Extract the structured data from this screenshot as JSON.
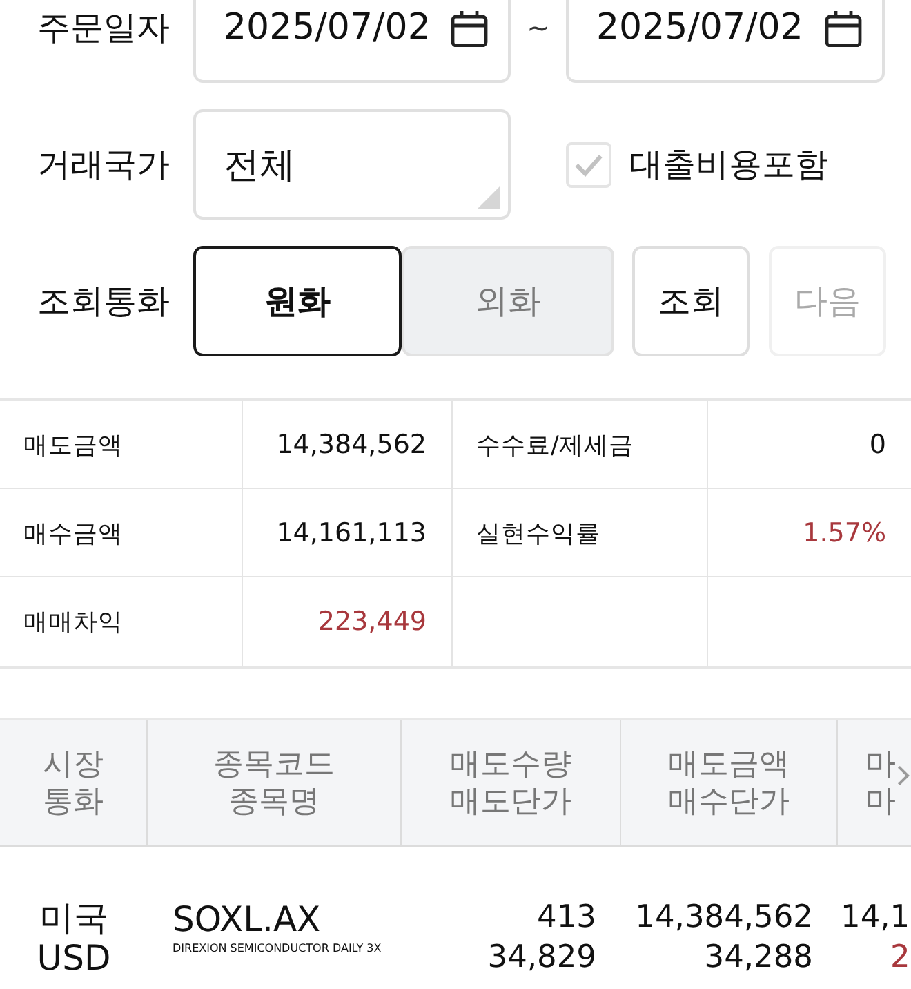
{
  "order_date": {
    "label": "주문일자",
    "from": "2025/07/02",
    "separator": "~",
    "to": "2025/07/02"
  },
  "trade_country": {
    "label": "거래국가",
    "value": "전체"
  },
  "loan_cost_option": {
    "label": "대출비용포함",
    "checked": true,
    "disabled": true
  },
  "currency": {
    "label": "조회통화",
    "options": [
      {
        "label": "원화",
        "selected": true
      },
      {
        "label": "외화",
        "selected": false
      }
    ]
  },
  "actions": [
    {
      "label": "조회",
      "disabled": false
    },
    {
      "label": "다음",
      "disabled": true
    }
  ],
  "summary": [
    {
      "label": "매도금액",
      "value": "14,384,562",
      "color": "#111111"
    },
    {
      "label": "수수료/제세금",
      "value": "0",
      "color": "#111111"
    },
    {
      "label": "매수금액",
      "value": "14,161,113",
      "color": "#111111"
    },
    {
      "label": "실현수익률",
      "value": "1.57%",
      "color": "#a8383d"
    },
    {
      "label": "매매차익",
      "value": "223,449",
      "color": "#a8383d"
    }
  ],
  "table": {
    "columns": [
      {
        "lines": [
          "시장",
          "통화"
        ]
      },
      {
        "lines": [
          "종목코드",
          "종목명"
        ]
      },
      {
        "lines": [
          "매도수량",
          "매도단가"
        ]
      },
      {
        "lines": [
          "매도금액",
          "매수단가"
        ]
      },
      {
        "lines": [
          "마",
          "마"
        ]
      }
    ],
    "rows": [
      {
        "cells": [
          {
            "kind": "text",
            "lines": [
              {
                "text": "미국"
              },
              {
                "text": "USD"
              }
            ]
          },
          {
            "kind": "instrument",
            "code": "SOXL.AX",
            "name": "DIREXION SEMICONDUCTOR DAILY 3X"
          },
          {
            "kind": "number",
            "lines": [
              {
                "text": "413",
                "color": "#111111"
              },
              {
                "text": "34,829",
                "color": "#111111"
              }
            ]
          },
          {
            "kind": "number",
            "lines": [
              {
                "text": "14,384,562",
                "color": "#111111"
              },
              {
                "text": "34,288",
                "color": "#111111"
              }
            ]
          },
          {
            "kind": "cut",
            "lines": [
              {
                "text": "14,1",
                "color": "#111111"
              },
              {
                "text": "2",
                "color": "#a8383d"
              }
            ]
          }
        ]
      }
    ]
  }
}
